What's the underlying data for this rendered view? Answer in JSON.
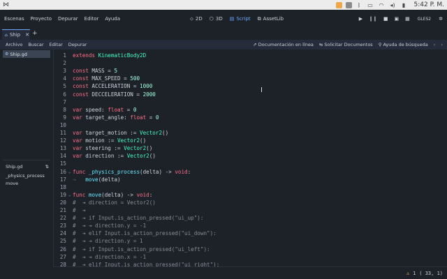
{
  "os": {
    "clock": "5:42 P. M."
  },
  "menu": [
    "Escenas",
    "Proyecto",
    "Depurar",
    "Editor",
    "Ayuda"
  ],
  "workspaces": [
    {
      "label": "2D",
      "icon": "2d-icon",
      "active": false
    },
    {
      "label": "3D",
      "icon": "3d-icon",
      "active": false
    },
    {
      "label": "Script",
      "icon": "script-icon",
      "active": true
    },
    {
      "label": "AssetLib",
      "icon": "assetlib-icon",
      "active": false
    }
  ],
  "renderer": "GLES2",
  "scene_tab": {
    "label": "Ship"
  },
  "script_menu": [
    "Archivo",
    "Buscar",
    "Editar",
    "Depurar"
  ],
  "script_links": [
    "Documentación en línea",
    "Solicitar Documentos",
    "Ayuda de búsqueda"
  ],
  "open_files": [
    {
      "label": "Ship.gd"
    }
  ],
  "methods_panel": {
    "title": "Ship.gd",
    "items": [
      "_physics_process",
      "move"
    ]
  },
  "code_lines": [
    {
      "n": "1",
      "fold": "",
      "html": "<span class=\"kw\">extends</span> <span class=\"ty\">KinematicBody2D</span>"
    },
    {
      "n": "2",
      "fold": "",
      "html": ""
    },
    {
      "n": "3",
      "fold": "",
      "html": "<span class=\"kw\">const</span> MASS = <span class=\"nm\">5</span>"
    },
    {
      "n": "4",
      "fold": "",
      "html": "<span class=\"kw\">const</span> MAX_SPEED = <span class=\"nm\">500</span>"
    },
    {
      "n": "5",
      "fold": "",
      "html": "<span class=\"kw\">const</span> ACCELERATION = <span class=\"nm\">1000</span>"
    },
    {
      "n": "6",
      "fold": "",
      "html": "<span class=\"kw\">const</span> DECCELERATION = <span class=\"nm\">2000</span>"
    },
    {
      "n": "7",
      "fold": "",
      "html": ""
    },
    {
      "n": "8",
      "fold": "",
      "html": "<span class=\"kw\">var</span> speed: <span class=\"kw\">float</span> = <span class=\"nm\">0</span>"
    },
    {
      "n": "9",
      "fold": "",
      "html": "<span class=\"kw\">var</span> target_angle: <span class=\"kw\">float</span> = <span class=\"nm\">0</span>"
    },
    {
      "n": "10",
      "fold": "",
      "html": ""
    },
    {
      "n": "11",
      "fold": "",
      "html": "<span class=\"kw\">var</span> target_motion := <span class=\"ty\">Vector2</span>()"
    },
    {
      "n": "12",
      "fold": "",
      "html": "<span class=\"kw\">var</span> motion := <span class=\"ty\">Vector2</span>()"
    },
    {
      "n": "13",
      "fold": "",
      "html": "<span class=\"kw\">var</span> steering := <span class=\"ty\">Vector2</span>()"
    },
    {
      "n": "14",
      "fold": "",
      "html": "<span class=\"kw\">var</span> direction := <span class=\"ty\">Vector2</span>()"
    },
    {
      "n": "15",
      "fold": "",
      "html": ""
    },
    {
      "n": "16",
      "fold": "⌄",
      "html": "<span class=\"kw\">func</span> <span class=\"fn\">_physics_process</span>(delta) -&gt; <span class=\"kw\">void</span>:"
    },
    {
      "n": "17",
      "fold": "",
      "html": "<span class=\"tabmark\">⇥</span>   <span class=\"fn\">move</span>(delta)"
    },
    {
      "n": "18",
      "fold": "",
      "html": ""
    },
    {
      "n": "19",
      "fold": "⌄",
      "html": "<span class=\"kw\">func</span> <span class=\"fn\">move</span>(delta) -&gt; <span class=\"kw\">void</span>:"
    },
    {
      "n": "20",
      "fold": "",
      "html": "<span class=\"cm\">#  ⇥ direction = Vector2()</span>"
    },
    {
      "n": "21",
      "fold": "",
      "html": "<span class=\"cm\">#  ⇥</span>"
    },
    {
      "n": "22",
      "fold": "",
      "html": "<span class=\"cm\">#  ⇥ if Input.is_action_pressed(\"ui_up\"):</span>"
    },
    {
      "n": "23",
      "fold": "",
      "html": "<span class=\"cm\">#  ⇥ ⇥ direction.y = -1</span>"
    },
    {
      "n": "24",
      "fold": "",
      "html": "<span class=\"cm\">#  ⇥ elif Input.is_action_pressed(\"ui_down\"):</span>"
    },
    {
      "n": "25",
      "fold": "",
      "html": "<span class=\"cm\">#  ⇥ ⇥ direction.y = 1</span>"
    },
    {
      "n": "26",
      "fold": "",
      "html": "<span class=\"cm\">#  ⇥ if Input.is_action_pressed(\"ui_left\"):</span>"
    },
    {
      "n": "27",
      "fold": "",
      "html": "<span class=\"cm\">#  ⇥ ⇥ direction.x = -1</span>"
    },
    {
      "n": "28",
      "fold": "",
      "html": "<span class=\"cm\">#  ⇥ elif Input.is_action_pressed(\"ui_right\"):</span>"
    }
  ],
  "status": {
    "warnings": "1",
    "position": "(  33,   1)"
  },
  "colors": {
    "background": "#1d2229",
    "panel": "#262c3b",
    "accent": "#6aa9ff",
    "keyword": "#ff7085",
    "type": "#42ffc2",
    "number": "#a1ffe0",
    "string": "#ffeda1",
    "function": "#66e6ff"
  }
}
